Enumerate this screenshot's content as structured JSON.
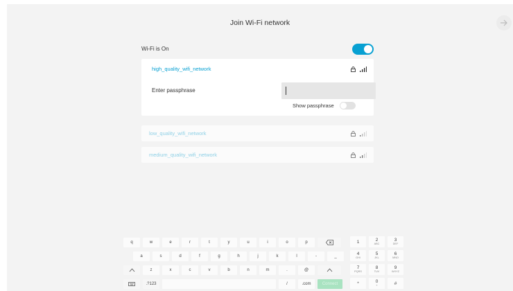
{
  "header": {
    "title": "Join Wi-Fi network"
  },
  "wifi": {
    "status_label": "Wi-Fi is On",
    "enabled": true
  },
  "selected_network": {
    "name": "high_quality_wifi_network",
    "passphrase_label": "Enter passphrase",
    "passphrase_value": "",
    "show_passphrase_label": "Show passphrase",
    "show_passphrase": false
  },
  "other_networks": [
    {
      "name": "low_quality_wifi_network"
    },
    {
      "name": "medium_quality_wifi_network"
    }
  ],
  "keyboard": {
    "row1": [
      "q",
      "w",
      "e",
      "r",
      "t",
      "y",
      "u",
      "i",
      "o",
      "p"
    ],
    "row2": [
      "a",
      "s",
      "d",
      "f",
      "g",
      "h",
      "j",
      "k",
      "l",
      "-",
      "_"
    ],
    "row3": [
      "z",
      "x",
      "c",
      "v",
      "b",
      "n",
      "m",
      ".",
      "@"
    ],
    "sym_label": ".?123",
    "slash_label": "/",
    "dotcom_label": ".com",
    "connect_label": "Connect"
  },
  "numpad": [
    {
      "n": "1",
      "l": ""
    },
    {
      "n": "2",
      "l": "ABC"
    },
    {
      "n": "3",
      "l": "DEF"
    },
    {
      "n": "4",
      "l": "GHI"
    },
    {
      "n": "5",
      "l": "JKL"
    },
    {
      "n": "6",
      "l": "MNO"
    },
    {
      "n": "7",
      "l": "PQRS"
    },
    {
      "n": "8",
      "l": "TUV"
    },
    {
      "n": "9",
      "l": "WXYZ"
    },
    {
      "n": "*",
      "l": ""
    },
    {
      "n": "0",
      "l": "+"
    },
    {
      "n": "#",
      "l": ""
    }
  ],
  "colors": {
    "accent": "#07a0d2",
    "connect": "#a9e3c1"
  }
}
